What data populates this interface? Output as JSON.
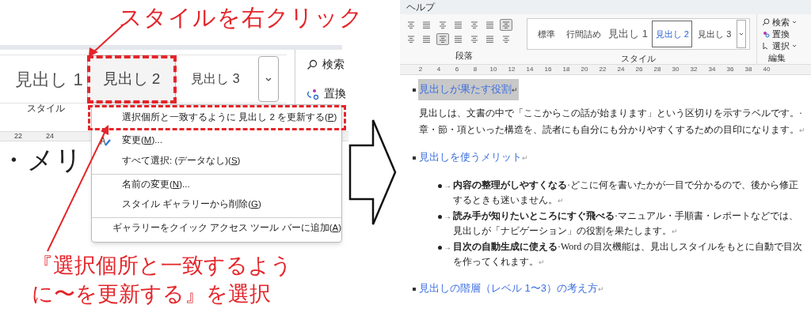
{
  "left_panel": {
    "callout_top": "スタイルを右クリック",
    "style_gallery": [
      {
        "label": "見出し 1",
        "selected": false
      },
      {
        "label": "見出し 2",
        "selected": true
      },
      {
        "label": "見出し 3",
        "selected": false
      }
    ],
    "edit_commands": [
      {
        "label": "検索"
      },
      {
        "label": "置換"
      }
    ],
    "group_label": "スタイル",
    "ruler_numbers": [
      "22",
      "24"
    ],
    "document_text": "・メリ",
    "context_menu": [
      {
        "label": "選択個所と一致するように 見出し 2 を更新する(",
        "accel": "P",
        "tail": ")",
        "has_icon": false,
        "separator_before": false
      },
      {
        "label": "変更(",
        "accel": "M",
        "tail": ")...",
        "has_icon": true,
        "separator_before": false
      },
      {
        "label": "すべて選択: (データなし)(",
        "accel": "S",
        "tail": ")",
        "has_icon": false,
        "separator_before": false
      },
      {
        "label": "名前の変更(",
        "accel": "N",
        "tail": ")...",
        "has_icon": false,
        "separator_before": true
      },
      {
        "label": "スタイル ギャラリーから削除(",
        "accel": "G",
        "tail": ")",
        "has_icon": false,
        "separator_before": false
      },
      {
        "label": "ギャラリーをクイック アクセス ツール バーに追加(",
        "accel": "A",
        "tail": ")",
        "has_icon": false,
        "separator_before": true
      }
    ],
    "callout_bottom": [
      "『選択個所と一致するよう",
      "に〜を更新する』を選択"
    ]
  },
  "right_panel": {
    "menu_tab": "ヘルプ",
    "paragraph_tools_row_1": [
      {
        "selected": false
      },
      {
        "selected": false
      },
      {
        "selected": false
      },
      {
        "selected": false
      },
      {
        "selected": false
      },
      {
        "selected": false
      },
      {
        "selected": true
      }
    ],
    "paragraph_tools_row_2": [
      {
        "selected": false
      },
      {
        "selected": false
      },
      {
        "selected": true
      },
      {
        "selected": false
      },
      {
        "selected": false
      },
      {
        "selected": false
      },
      {
        "selected": false
      }
    ],
    "styles": [
      {
        "label": "標準",
        "selected": false
      },
      {
        "label": "行間詰め",
        "selected": false
      },
      {
        "label": "見出し 1",
        "selected": false
      },
      {
        "label": "見出し 2",
        "selected": true
      },
      {
        "label": "見出し 3",
        "selected": false
      }
    ],
    "edit_commands": [
      {
        "label": "検索",
        "dropdown": true
      },
      {
        "label": "置換",
        "dropdown": false
      },
      {
        "label": "選択",
        "dropdown": true
      }
    ],
    "group_labels": [
      "段落",
      "スタイル",
      "編集"
    ],
    "ruler_numbers": [
      "2",
      "4",
      "6",
      "8",
      "10",
      "12",
      "14",
      "16",
      "18",
      "20",
      "22",
      "24",
      "26",
      "28",
      "30",
      "32",
      "34",
      "36",
      "38",
      "40"
    ],
    "document": [
      {
        "kind": "heading",
        "text": "見出しが果たす役割",
        "mark": "↵",
        "selected": true
      },
      {
        "kind": "paragraph",
        "text": "見出しは、文書の中で「ここからこの話が始まります」という区切りを示すラベルです。·章・節・項といった構造を、読者にも自分にも分かりやすくするための目印になります。",
        "mark": "↵"
      },
      {
        "kind": "heading",
        "text": "見出しを使うメリット",
        "mark": "↵",
        "selected": false
      },
      {
        "kind": "bullet",
        "tab": "→",
        "text": "**内容の整理がしやすくなる**·どこに何を書いたかが一目で分かるので、後から修正するときも迷いません。",
        "mark": "↵"
      },
      {
        "kind": "bullet",
        "tab": "→",
        "text": "**読み手が知りたいところにすぐ飛べる**·マニュアル・手順書・レポートなどでは、見出しが「ナビゲーション」の役割を果たします。",
        "mark": "↵"
      },
      {
        "kind": "bullet",
        "tab": "→",
        "text": "**目次の自動生成に使える**·Word の目次機能は、見出しスタイルをもとに自動で目次を作ってくれます。",
        "mark": "↵"
      },
      {
        "kind": "heading",
        "text": "見出しの階層（レベル 1〜3）の考え方",
        "mark": "↵",
        "selected": false
      }
    ]
  }
}
